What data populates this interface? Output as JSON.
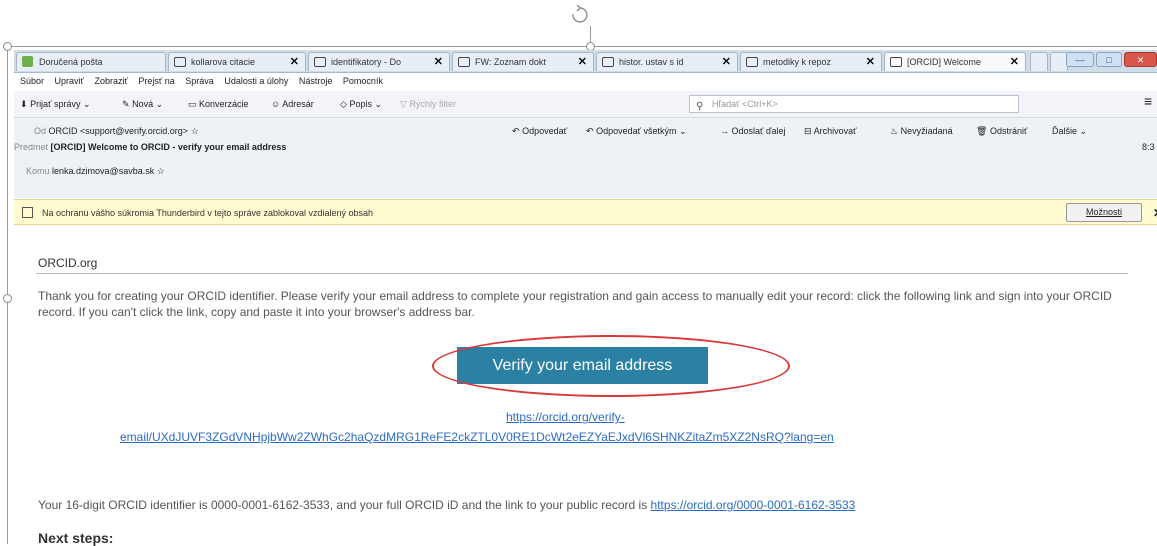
{
  "tabs": [
    {
      "label": "Doručená pošta",
      "icon": "inbox-icon"
    },
    {
      "label": "kollarova citacie",
      "icon": "mail-icon"
    },
    {
      "label": "identifikatory - Do",
      "icon": "mail-icon"
    },
    {
      "label": "FW: Zoznam dokt",
      "icon": "mail-icon"
    },
    {
      "label": "histor. ustav s id",
      "icon": "mail-icon"
    },
    {
      "label": "metodiky k repoz",
      "icon": "mail-icon"
    },
    {
      "label": "[ORCID] Welcome",
      "icon": "mail-icon"
    }
  ],
  "menubar": [
    "Súbor",
    "Upraviť",
    "Zobraziť",
    "Prejsť na",
    "Správa",
    "Udalosti a úlohy",
    "Nástroje",
    "Pomocník"
  ],
  "toolbar": {
    "get_messages": "Prijať správy",
    "new": "Nová",
    "conversations": "Konverzácie",
    "address_book": "Adresár",
    "tags": "Popis",
    "quick_filter": "Rýchly filter",
    "search_placeholder": "Hľadať <Ctrl+K>",
    "menu_glyph": "≡"
  },
  "header": {
    "from_label": "Od",
    "from_value": "ORCID <support@verify.orcid.org>",
    "subject_label": "Predmet",
    "subject_value": "[ORCID] Welcome to ORCID - verify your email address",
    "to_label": "Komu",
    "to_value": "lenka.dzimova@savba.sk",
    "time": "8:3",
    "actions": [
      "Odpovedať",
      "Odpovedať všetkým",
      "Odoslať ďalej",
      "Archivovať",
      "Nevyžiadaná",
      "Odstrániť",
      "Ďalšie"
    ]
  },
  "notification": {
    "text": "Na ochranu vášho súkromia Thunderbird v tejto správe zablokoval vzdialený obsah",
    "options_label": "Možnosti",
    "close_glyph": "✕"
  },
  "email": {
    "brand": "ORCID.org",
    "paragraph": "Thank you for creating your ORCID identifier. Please verify your email address to complete your registration and gain access to manually edit your record: click the following link and sign into your ORCID record. If you can't click the link, copy and paste it into your browser's address bar.",
    "verify_button": "Verify your email address",
    "link_line1": "https://orcid.org/verify-",
    "link_line2": "email/UXdJUVF3ZGdVNHpjbWw2ZWhGc2haQzdMRG1ReFE2ckZTL0V0RE1DcWt2eEZYaEJxdVl6SHNKZitaZm5XZ2NsRQ?lang=en",
    "id_text": "Your 16-digit ORCID identifier is 0000-0001-6162-3533, and your full ORCID iD and the link to your public record is ",
    "id_link": "https://orcid.org/0000-0001-6162-3533",
    "next_steps": "Next steps:"
  },
  "colors": {
    "verify_button_bg": "#2a81a3",
    "annotation_oval": "#d9383a",
    "link": "#2b6cc4",
    "notification_bg": "#fffbd1"
  }
}
